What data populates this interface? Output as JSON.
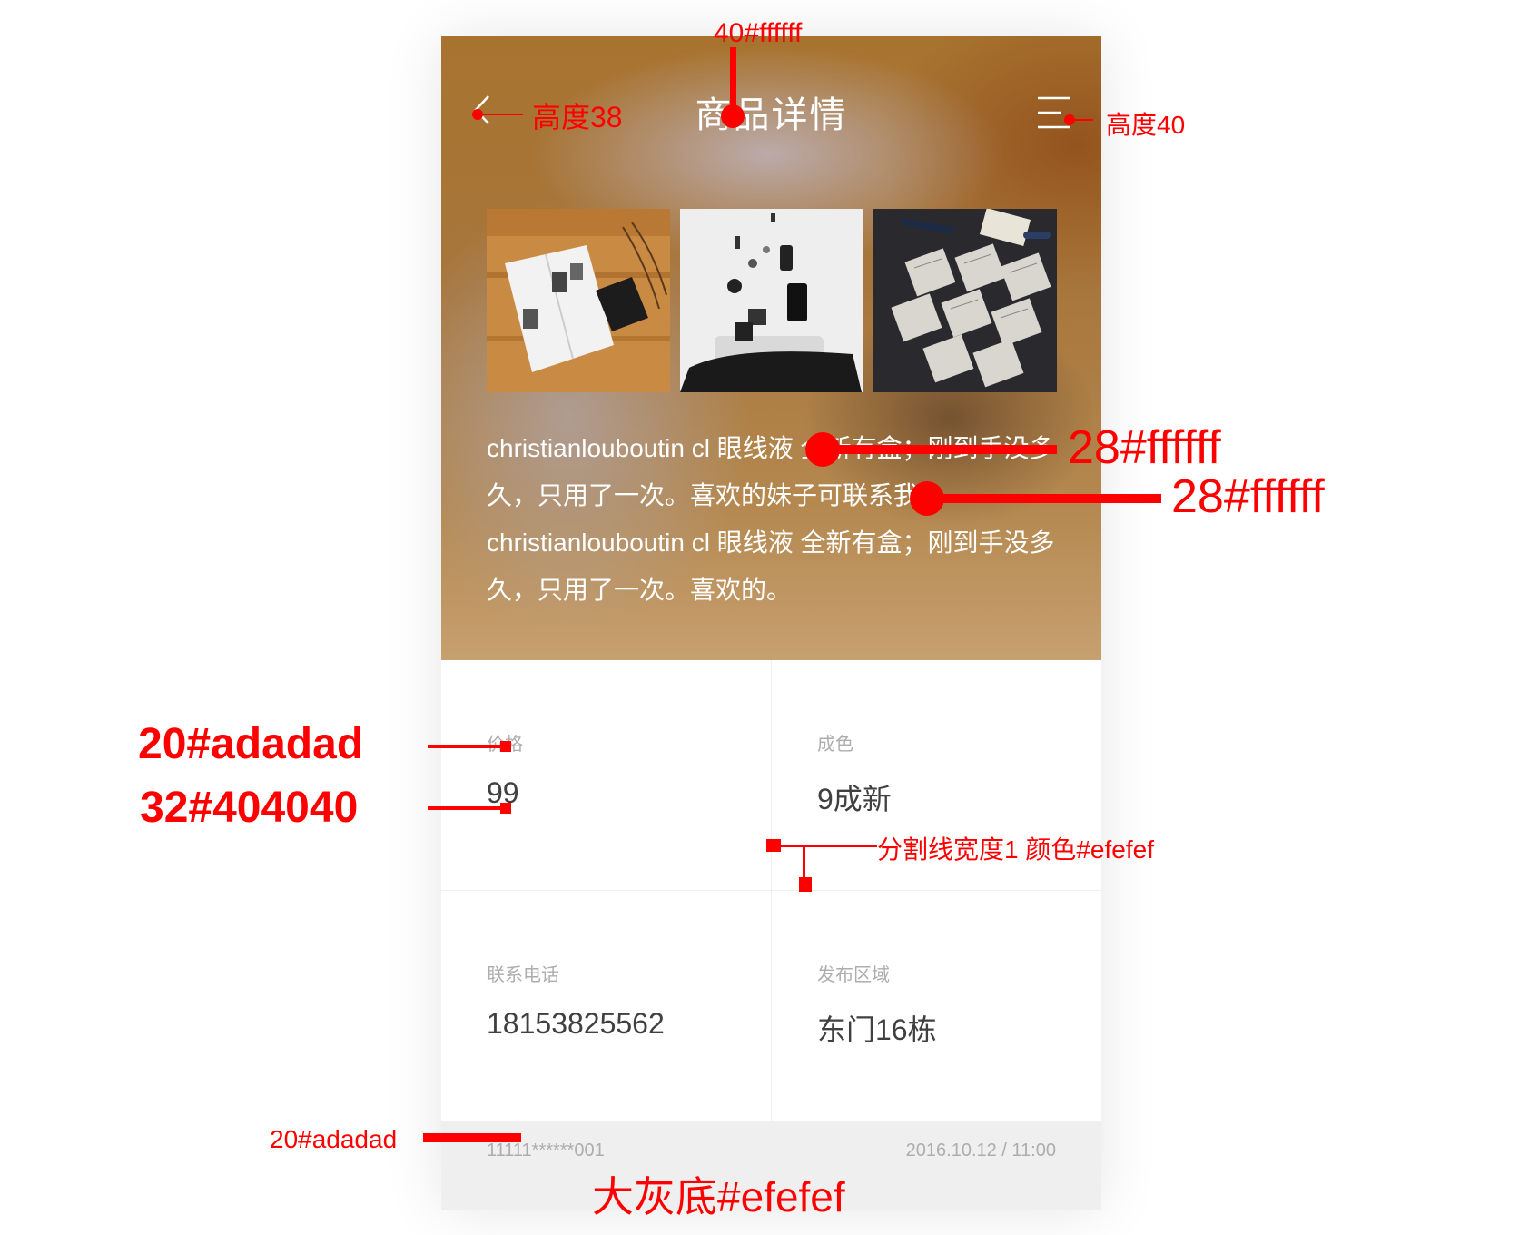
{
  "header": {
    "title": "商品详情"
  },
  "product": {
    "description": "christianlouboutin cl 眼线液 全新有盒；刚到手没多久，只用了一次。喜欢的妹子可联系我。christianlouboutin cl 眼线液 全新有盒；刚到手没多久，只用了一次。喜欢的。"
  },
  "details": {
    "price": {
      "label": "价格",
      "value": "99"
    },
    "condition": {
      "label": "成色",
      "value": "9成新"
    },
    "phone": {
      "label": "联系电话",
      "value": "18153825562"
    },
    "area": {
      "label": "发布区域",
      "value": "东门16栋"
    }
  },
  "footer": {
    "id": "11111******001",
    "datetime": "2016.10.12 / 11:00"
  },
  "annotations": {
    "title_spec": "40#ffffff",
    "back_height": "高度38",
    "menu_height": "高度40",
    "desc_spec_1": "28#ffffff",
    "desc_spec_2": "28#ffffff",
    "label_spec": "20#adadad",
    "value_spec": "32#404040",
    "divider_spec": "分割线宽度1 颜色#efefef",
    "footer_spec": "20#adadad",
    "bg_spec": "大灰底#efefef"
  },
  "colors": {
    "annotation": "#ff0000",
    "label": "#adadad",
    "value": "#404040",
    "divider": "#efefef",
    "footer_bg": "#efefef",
    "title": "#ffffff"
  }
}
